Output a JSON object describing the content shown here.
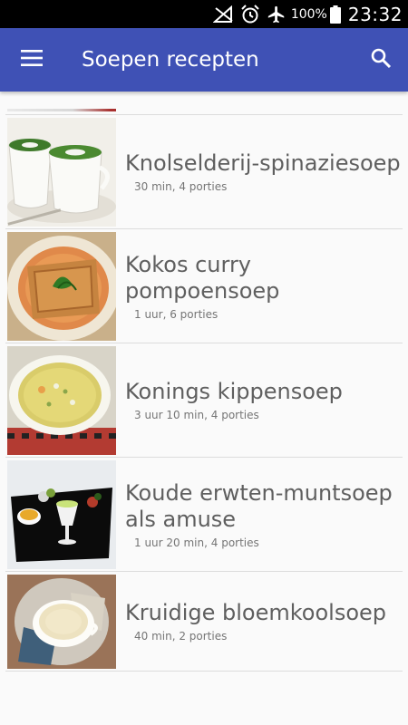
{
  "status_bar": {
    "battery_text": "100%",
    "time": "23:32",
    "icons": [
      "no-signal-icon",
      "alarm-icon",
      "airplane-mode-icon",
      "battery-icon"
    ]
  },
  "app_bar": {
    "title": "Soepen recepten",
    "menu_icon": "hamburger-menu-icon",
    "search_icon": "search-icon",
    "color": "#3f51b5"
  },
  "recipes": [
    {
      "name": "Knolselderij-spinaziesoep",
      "meta": "30 min, 4 porties"
    },
    {
      "name": "Kokos curry pompoensoep",
      "meta": "1 uur, 6 porties"
    },
    {
      "name": "Konings kippensoep",
      "meta": "3 uur 10 min, 4 porties"
    },
    {
      "name": "Koude erwten-muntsoep als amuse",
      "meta": "1 uur 20 min, 4 porties"
    },
    {
      "name": "Kruidige bloemkoolsoep",
      "meta": "40 min, 2 porties"
    }
  ]
}
